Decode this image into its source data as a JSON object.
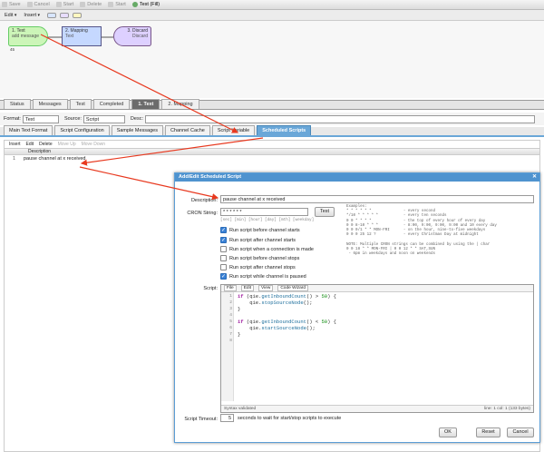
{
  "toolbar": {
    "items": [
      "Save",
      "Cancel",
      "Start",
      "Delete",
      "Start",
      "Test (Fill)"
    ]
  },
  "subbar": {
    "edit": "Edit",
    "insert": "Insert"
  },
  "nodes": [
    {
      "title": "1. Text",
      "subtitle": "add message",
      "footer": "45"
    },
    {
      "title": "2. Mapping",
      "subtitle": "Text"
    },
    {
      "title": "3. Discard",
      "subtitle": "Discard"
    }
  ],
  "tabs1": [
    "Status",
    "Messages",
    "Test",
    "Completed",
    "1. Text",
    "2. Mapping"
  ],
  "format": {
    "format_label": "Format:",
    "format_value": "Text",
    "source_label": "Source:",
    "source_value": "Script",
    "desc_label": "Desc:"
  },
  "tabs2": [
    "Main Text Format",
    "Script Configuration",
    "Sample Messages",
    "Channel Cache",
    "Script Variable",
    "Scheduled Scripts"
  ],
  "list": {
    "menu": [
      "Insert",
      "Edit",
      "Delete",
      "Move Up",
      "Move Down"
    ],
    "header": "Description",
    "rows": [
      {
        "num": "1",
        "text": "pause channel at x received"
      }
    ]
  },
  "dialog": {
    "title": "Add/Edit Scheduled Script",
    "desc_label": "Description:",
    "desc_value": "pause channel at x received",
    "cron_label": "CRON String:",
    "cron_value": "* * * * * *",
    "test_button": "Test",
    "cron_hint": "[sec] [min] [hour] [day] [mth] [weekday]",
    "examples": "Examples:\n* * * * * *              - every second\n*/10 * * * * *           - every ten seconds\n0 0 * * * *              - the top of every hour of every day\n0 0 8-10 * * *           - 8:00, 9:00, 9:00, 9:00 and 10 every day\n0 0 0/1 * * MON-FRI      - on the hour, nine-to-five weekdays\n0 0 0 25 12 ?            - every Christmas Day at midnight\n\nNOTE: Multiple CRON strings can be combined by using the | char\n0 0 18 * * MON-FRI | 0 0 12 * * SAT,SUN\n - 6pm in weekdays and noon on weekends",
    "checkboxes": [
      {
        "label": "Run script before channel starts",
        "checked": true
      },
      {
        "label": "Run script after channel starts",
        "checked": true
      },
      {
        "label": "Run script when a connection is made",
        "checked": false
      },
      {
        "label": "Run script before channel stops",
        "checked": false
      },
      {
        "label": "Run script after channel stops",
        "checked": false
      },
      {
        "label": "Run script while channel is paused",
        "checked": true
      }
    ],
    "script_label": "Script:",
    "editor_menu": [
      "File",
      "Edit",
      "View",
      "Code Wizard"
    ],
    "status_left": "Syntax validated",
    "status_right": "line: 1  col: 1  (133 bytes)",
    "timeout_label": "Script Timeout:",
    "timeout_value": "5",
    "timeout_hint": "seconds to wait for start/stop scripts to execute",
    "ok": "OK",
    "reset": "Reset",
    "cancel": "Cancel"
  }
}
